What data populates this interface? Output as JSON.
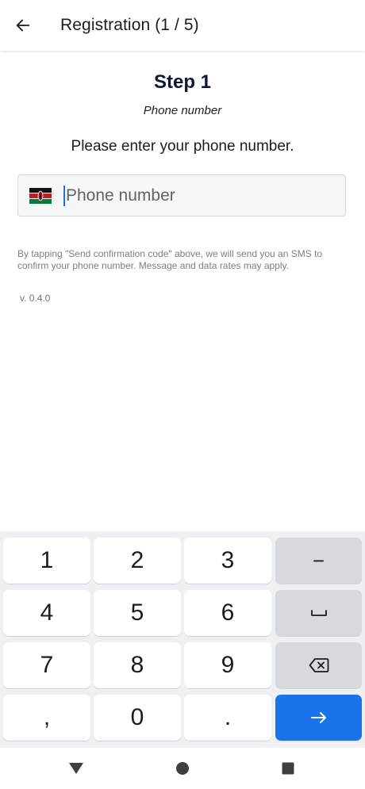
{
  "appbar": {
    "title": "Registration (1 / 5)"
  },
  "content": {
    "step_title": "Step 1",
    "step_subtitle": "Phone number",
    "prompt": "Please enter your phone number.",
    "phone_field": {
      "placeholder": "Phone number",
      "value": "",
      "flag_icon": "kenya-flag-icon"
    },
    "disclaimer": "By tapping \"Send confirmation code\" above, we will send you an SMS to confirm your phone number. Message and data rates may apply.",
    "version": "v. 0.4.0"
  },
  "keyboard": {
    "keys": [
      "1",
      "2",
      "3",
      "−",
      "4",
      "5",
      "6",
      "␣",
      "7",
      "8",
      "9",
      "⌫",
      ",",
      "0",
      ".",
      "→"
    ],
    "colors": {
      "key": "#ffffff",
      "function_key": "#d6d9de",
      "action_key": "#1a73e8",
      "background": "#eef0f4"
    }
  },
  "navbar": {
    "icons": [
      "back-triangle-icon",
      "home-circle-icon",
      "recents-square-icon"
    ]
  }
}
